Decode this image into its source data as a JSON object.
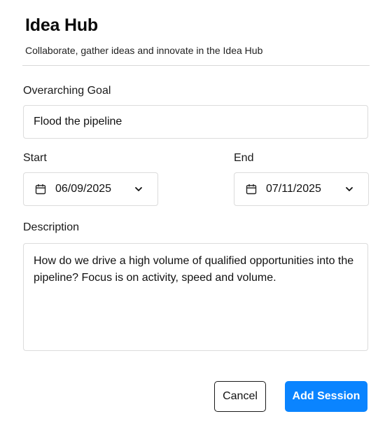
{
  "header": {
    "title": "Idea Hub",
    "subtitle": "Collaborate, gather ideas and innovate in the Idea Hub"
  },
  "form": {
    "goal_label": "Overarching Goal",
    "goal_value": "Flood the pipeline",
    "start_label": "Start",
    "start_value": "06/09/2025",
    "end_label": "End",
    "end_value": "07/11/2025",
    "description_label": "Description",
    "description_value": "How do we drive a high volume of qualified opportunities into the pipeline? Focus is on activity, speed and volume."
  },
  "actions": {
    "cancel_label": "Cancel",
    "submit_label": "Add Session"
  },
  "colors": {
    "primary": "#0a84ff",
    "border": "#dcdcdc"
  },
  "icons": {
    "date_icon": "calendar-icon",
    "dropdown_icon": "chevron-down-icon"
  }
}
